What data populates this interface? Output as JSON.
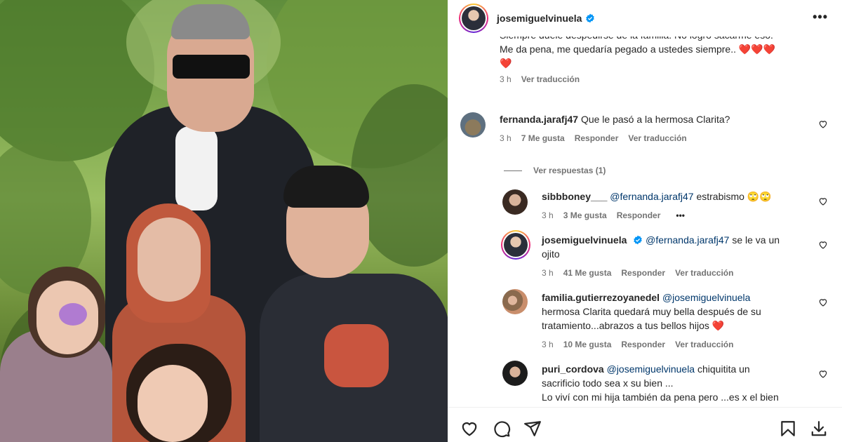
{
  "post": {
    "username": "josemiguelvinuela",
    "more_label": "•••"
  },
  "caption_tail": {
    "line1": "Siempre duele despedirse de la familia. No logro sacarme eso.",
    "line2": "Me da pena, me quedaría pegado a ustedes siempre.. ❤️❤️❤️",
    "line3": "❤️",
    "time": "3 h",
    "translate": "Ver traducción"
  },
  "comments": [
    {
      "username": "fernanda.jarafj47",
      "text": "Que le pasó a la hermosa Clarita?",
      "time": "3 h",
      "likes": "7 Me gusta",
      "reply": "Responder",
      "translate": "Ver traducción",
      "view_replies": "Ver respuestas (1)"
    },
    {
      "username": "sibbboney___",
      "mention": "@fernanda.jarafj47",
      "text": "estrabismo 🙄🙄",
      "time": "3 h",
      "likes": "3 Me gusta",
      "reply": "Responder",
      "more": "•••"
    },
    {
      "username": "josemiguelvinuela",
      "mention": "@fernanda.jarafj47",
      "text": "se le va un",
      "text2": "ojito",
      "time": "3 h",
      "likes": "41 Me gusta",
      "reply": "Responder",
      "translate": "Ver traducción"
    },
    {
      "username": "familia.gutierrezoyanedel",
      "mention": "@josemiguelvinuela",
      "text": "hermosa Clarita quedará muy bella después de su",
      "text2": "tratamiento...abrazos a tus bellos hijos ❤️",
      "time": "3 h",
      "likes": "10 Me gusta",
      "reply": "Responder",
      "translate": "Ver traducción"
    },
    {
      "username": "puri_cordova",
      "mention": "@josemiguelvinuela",
      "text": "chiquitita un",
      "text2": "sacrificio todo sea x su bien ...",
      "text3": "Lo viví con mi hija también da pena pero ...es x el bien"
    }
  ],
  "colors": {
    "accent": "#0095f6",
    "mention": "#00376b",
    "meta": "#737373",
    "heart": "#ed4956"
  },
  "icons": [
    "heart-icon",
    "comment-icon",
    "share-icon",
    "bookmark-icon",
    "download-icon",
    "verified-icon",
    "more-icon"
  ]
}
